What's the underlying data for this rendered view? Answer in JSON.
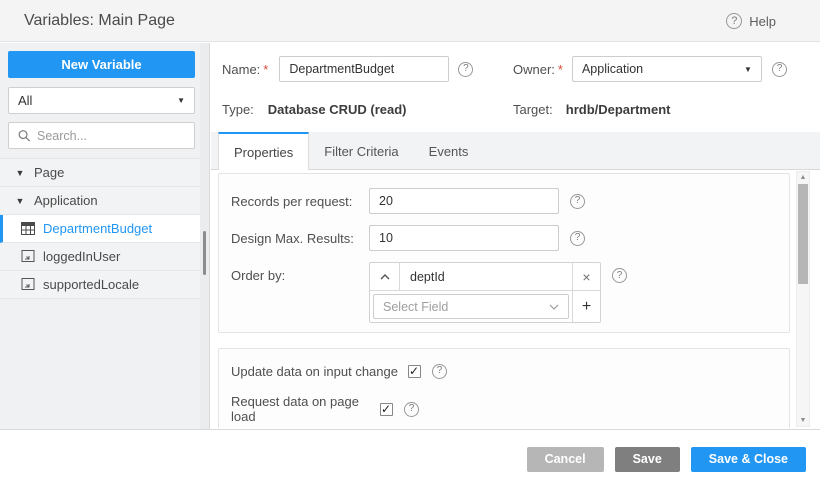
{
  "header": {
    "title": "Variables: Main Page",
    "help_label": "Help"
  },
  "icons": {
    "help": "?",
    "select_caret": "▼",
    "tree_caret": "▼",
    "close": "×",
    "plus": "+",
    "scroll_up": "▲",
    "scroll_down": "▼"
  },
  "sidebar": {
    "new_variable_label": "New Variable",
    "filter_value": "All",
    "search_placeholder": "Search...",
    "tree": [
      {
        "label": "Page",
        "type": "group",
        "expanded": true
      },
      {
        "label": "Application",
        "type": "group",
        "expanded": true
      },
      {
        "label": "DepartmentBudget",
        "type": "variable",
        "icon": "database-crud-variable-icon",
        "selected": true
      },
      {
        "label": "loggedInUser",
        "type": "variable",
        "icon": "static-variable-icon",
        "selected": false
      },
      {
        "label": "supportedLocale",
        "type": "variable",
        "icon": "static-variable-icon",
        "selected": false
      }
    ]
  },
  "details": {
    "required_mark": "*",
    "name_label": "Name:",
    "name_value": "DepartmentBudget",
    "owner_label": "Owner:",
    "owner_value": "Application",
    "type_label": "Type:",
    "type_value": "Database CRUD (read)",
    "target_label": "Target:",
    "target_value": "hrdb/Department"
  },
  "tabs": [
    {
      "label": "Properties",
      "active": true
    },
    {
      "label": "Filter Criteria",
      "active": false
    },
    {
      "label": "Events",
      "active": false
    }
  ],
  "properties": {
    "records_per_request": {
      "label": "Records per request:",
      "value": "20"
    },
    "design_max_results": {
      "label": "Design Max. Results:",
      "value": "10"
    },
    "order_by": {
      "label": "Order by:",
      "entry_value": "deptId",
      "select_placeholder": "Select Field"
    },
    "checkboxes": [
      {
        "label": "Update data on input change",
        "checked": true
      },
      {
        "label": "Request data on page load",
        "checked": true
      }
    ]
  },
  "footer": {
    "cancel_label": "Cancel",
    "save_label": "Save",
    "save_close_label": "Save & Close"
  },
  "colors": {
    "accent_blue": "#2196f3",
    "cancel_gray": "#b6b6b6",
    "save_gray": "#7f7f7f",
    "header_bg": "#f4f4f4",
    "sidebar_bg": "#f0f1f2",
    "required_red": "#e04b3a"
  }
}
